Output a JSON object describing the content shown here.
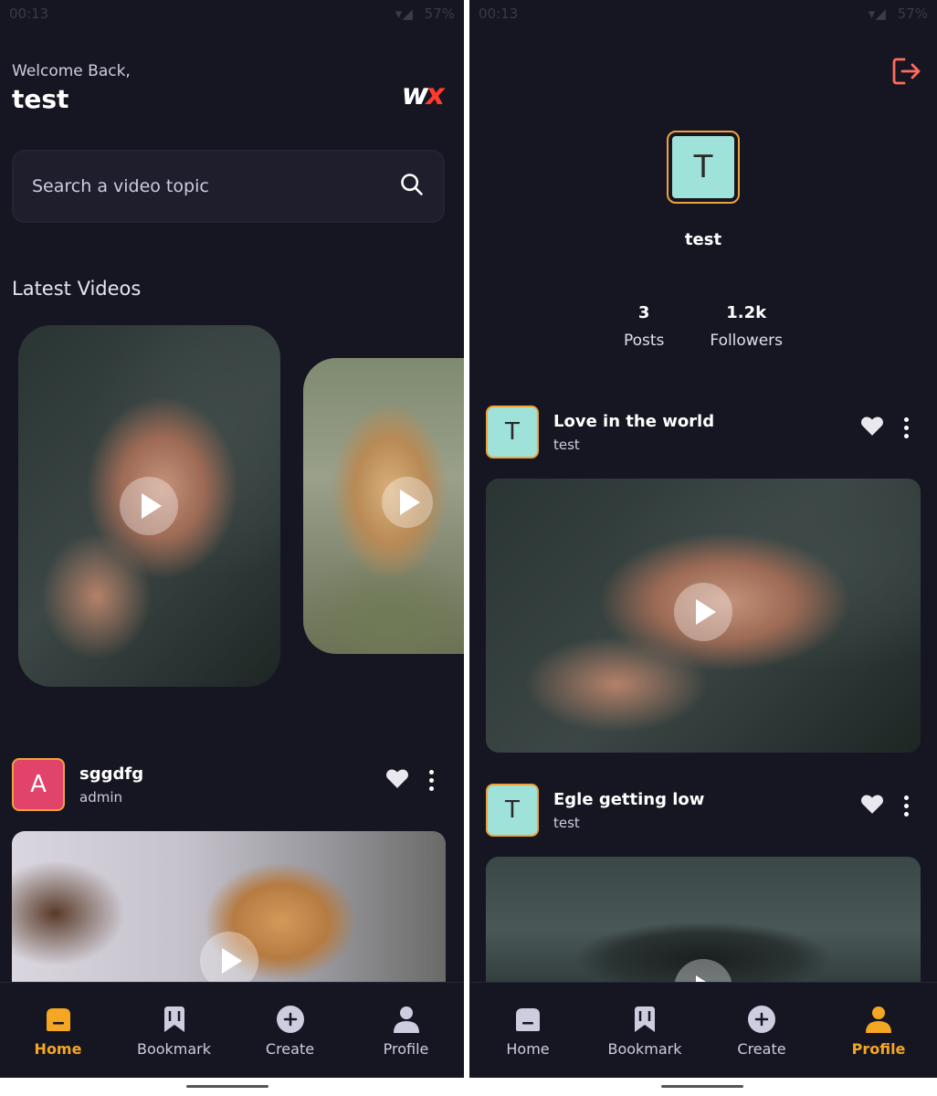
{
  "status_bar": {
    "time": "00:13",
    "battery": "57%"
  },
  "home": {
    "welcome": "Welcome Back,",
    "username": "test",
    "logo": {
      "left": "w",
      "right": "x"
    },
    "search_placeholder": "Search a video topic",
    "section_title": "Latest Videos",
    "post": {
      "title": "sggdfg",
      "author": "admin",
      "avatar_letter": "A"
    }
  },
  "profile": {
    "avatar_letter": "T",
    "username": "test",
    "stats": [
      {
        "value": "3",
        "label": "Posts"
      },
      {
        "value": "1.2k",
        "label": "Followers"
      }
    ],
    "posts": [
      {
        "title": "Love in the world",
        "author": "test",
        "avatar_letter": "T"
      },
      {
        "title": "Egle getting low",
        "author": "test",
        "avatar_letter": "T"
      }
    ]
  },
  "tabs": [
    {
      "label": "Home",
      "icon": "home-icon"
    },
    {
      "label": "Bookmark",
      "icon": "bookmark-icon"
    },
    {
      "label": "Create",
      "icon": "plus-circle-icon"
    },
    {
      "label": "Profile",
      "icon": "profile-icon"
    }
  ],
  "colors": {
    "accent": "#f5a623",
    "background": "#161622",
    "logout": "#ff6b5b"
  }
}
